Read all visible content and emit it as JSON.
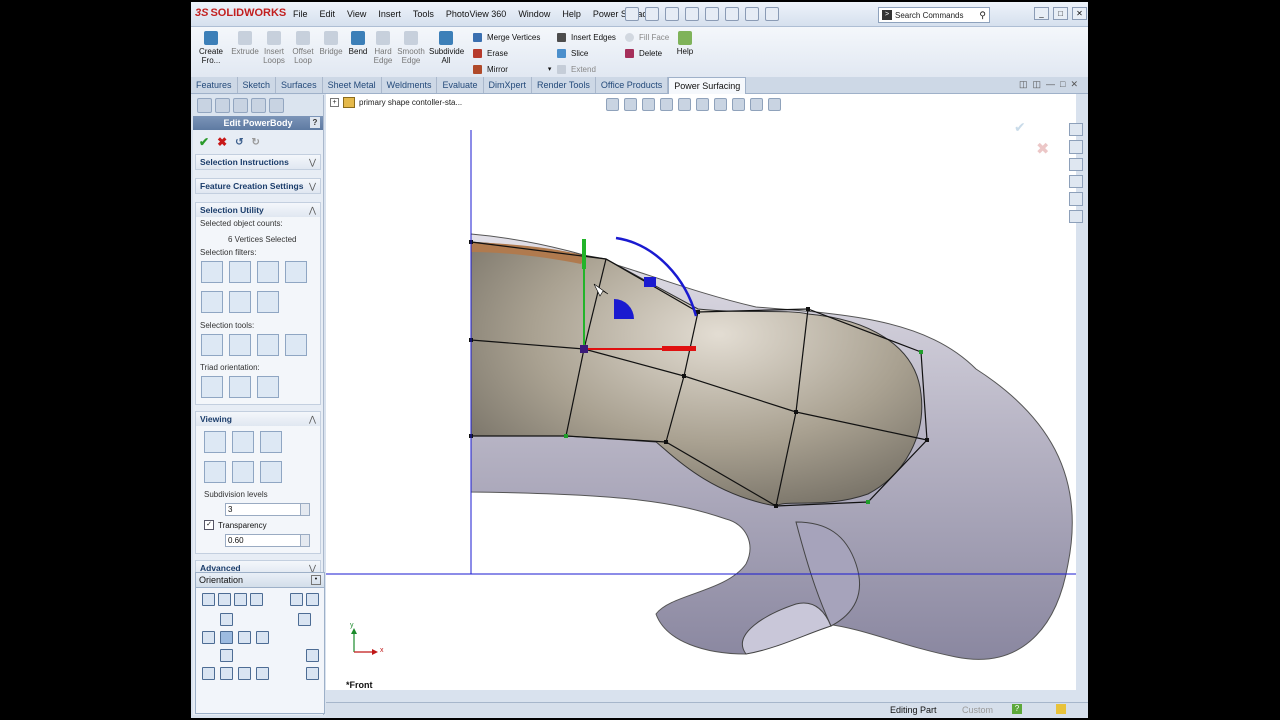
{
  "app": {
    "brand": "SOLIDWORKS",
    "menu": [
      "File",
      "Edit",
      "View",
      "Insert",
      "Tools",
      "PhotoView 360",
      "Window",
      "Help",
      "Power Surfacing"
    ],
    "search_placeholder": "Search Commands"
  },
  "ribbon": {
    "buttons": [
      {
        "label": "Create Fro...",
        "enabled": true
      },
      {
        "label": "Extrude",
        "enabled": false
      },
      {
        "label": "Insert Loops",
        "enabled": false
      },
      {
        "label": "Offset Loop",
        "enabled": false
      },
      {
        "label": "Bridge",
        "enabled": false
      },
      {
        "label": "Bend",
        "enabled": true
      },
      {
        "label": "Hard Edge",
        "enabled": false
      },
      {
        "label": "Smooth Edge",
        "enabled": false
      },
      {
        "label": "Subdivide All",
        "enabled": true
      }
    ],
    "col1": [
      "Merge Vertices",
      "Erase",
      "Mirror"
    ],
    "col2": [
      "Insert Edges",
      "Slice",
      "Extend"
    ],
    "col3": [
      "Fill Face",
      "Delete"
    ],
    "help": "Help"
  },
  "tabs": [
    "Features",
    "Sketch",
    "Surfaces",
    "Sheet Metal",
    "Weldments",
    "Evaluate",
    "DimXpert",
    "Render Tools",
    "Office Products",
    "Power Surfacing"
  ],
  "active_tab": "Power Surfacing",
  "property_manager": {
    "title": "Edit PowerBody",
    "help": "?",
    "groups": {
      "selection_instructions": "Selection Instructions",
      "feature_creation_settings": "Feature Creation Settings",
      "selection_utility": "Selection Utility",
      "viewing": "Viewing",
      "advanced": "Advanced"
    },
    "selected_object_counts_label": "Selected object counts:",
    "selected_count_text": "6 Vertices Selected",
    "selection_filters_label": "Selection filters:",
    "selection_tools_label": "Selection tools:",
    "triad_orientation_label": "Triad orientation:",
    "subdivision_levels_label": "Subdivision levels",
    "subdivision_levels_value": "3",
    "transparency_label": "Transparency",
    "transparency_checked": true,
    "transparency_value": "0.60"
  },
  "orientation_panel": {
    "title": "Orientation"
  },
  "viewport": {
    "breadcrumb": "primary shape contoller-sta...",
    "view_name": "*Front",
    "axis_x": "x",
    "axis_y": "y"
  },
  "status": {
    "mode": "Editing Part",
    "units": "Custom"
  },
  "colors": {
    "accent": "#3c7fb8",
    "manipulator_red": "#e01010",
    "manipulator_green": "#22b42a",
    "manipulator_blue": "#1a1ad0",
    "cage_line": "#111111"
  }
}
